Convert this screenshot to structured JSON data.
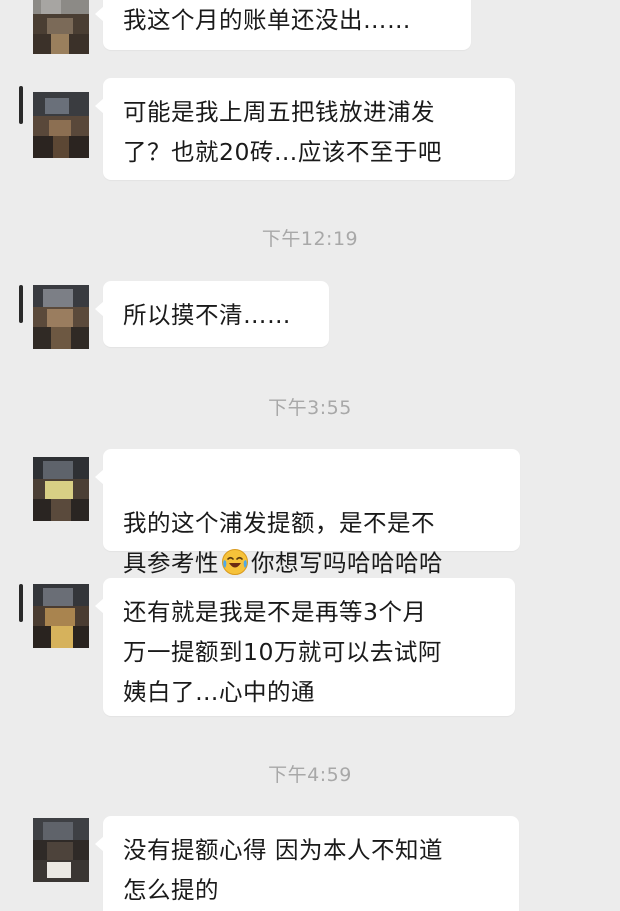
{
  "conversation": {
    "messages": [
      {
        "id": "m1",
        "text": "我这个月的账单还没出……"
      },
      {
        "id": "m2",
        "text": "可能是我上周五把钱放进浦发\n了？也就20砖…应该不至于吧"
      },
      {
        "id": "m3",
        "text": "所以摸不清……"
      },
      {
        "id": "m4",
        "text_part1": "我的这个浦发提额，是不是不\n具参考性",
        "emoji": "laughing-crying-emoji",
        "text_part2": "你想写吗哈哈哈哈"
      },
      {
        "id": "m5",
        "text": "还有就是我是不是再等3个月\n万一提额到10万就可以去试阿\n姨白了…心中的通"
      },
      {
        "id": "m6",
        "text": "没有提额心得 因为本人不知道\n怎么提的"
      }
    ],
    "timestamps": [
      {
        "id": "t1",
        "text": "下午12:19"
      },
      {
        "id": "t2",
        "text": "下午3:55"
      },
      {
        "id": "t3",
        "text": "下午4:59"
      }
    ]
  },
  "colors": {
    "background": "#ececec",
    "bubble": "#ffffff",
    "text": "#1a1a1a",
    "timestamp": "#a8a8a8"
  }
}
